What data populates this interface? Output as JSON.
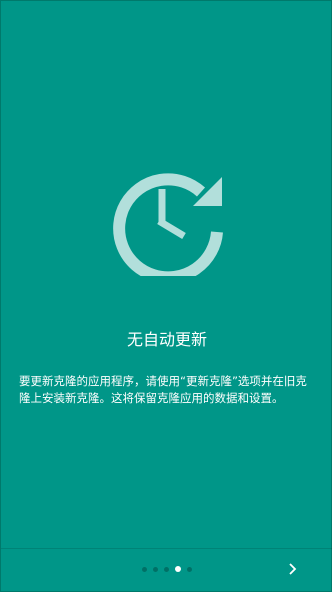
{
  "page": {
    "title": "无自动更新",
    "description": "要更新克隆的应用程序，请使用“更新克隆”选项并在旧克隆上安装新克隆。这将保留克隆应用的数据和设置。"
  },
  "hero": {
    "icon": "update-clock-icon",
    "icon_color": "#b2dfdb"
  },
  "pager": {
    "total": 5,
    "active_index": 3
  },
  "next": {
    "icon": "chevron-right-icon"
  },
  "colors": {
    "background": "#009688",
    "text": "#ffffff"
  }
}
